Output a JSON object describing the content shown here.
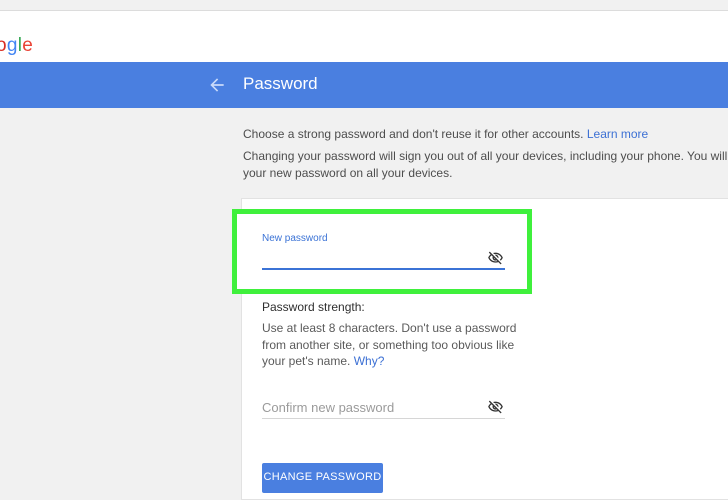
{
  "logo": {
    "letters": [
      "o",
      "g",
      "l",
      "e"
    ],
    "colors": [
      "#d93025",
      "#4285f4",
      "#34a853",
      "#ea4335"
    ]
  },
  "header": {
    "title": "Password",
    "back_icon": "arrow-left-icon"
  },
  "intro": {
    "line1": "Choose a strong password and don't reuse it for other accounts.",
    "learn_more": "Learn more",
    "line2a": "Changing your password will sign you out of all your devices, including your phone. You will need",
    "line2b": "your new password on all your devices."
  },
  "new_password": {
    "label": "New password",
    "value": "",
    "toggle_icon": "visibility-off-icon"
  },
  "strength": {
    "title": "Password strength:",
    "text": "Use at least 8 characters. Don't use a password from another site, or something too obvious like your pet's name.",
    "why": "Why?"
  },
  "confirm_password": {
    "placeholder": "Confirm new password",
    "toggle_icon": "visibility-off-icon"
  },
  "button": {
    "label": "CHANGE PASSWORD"
  },
  "colors": {
    "header": "#4a7fe0",
    "accent": "#3b73d6",
    "highlight": "#3ff03c"
  }
}
